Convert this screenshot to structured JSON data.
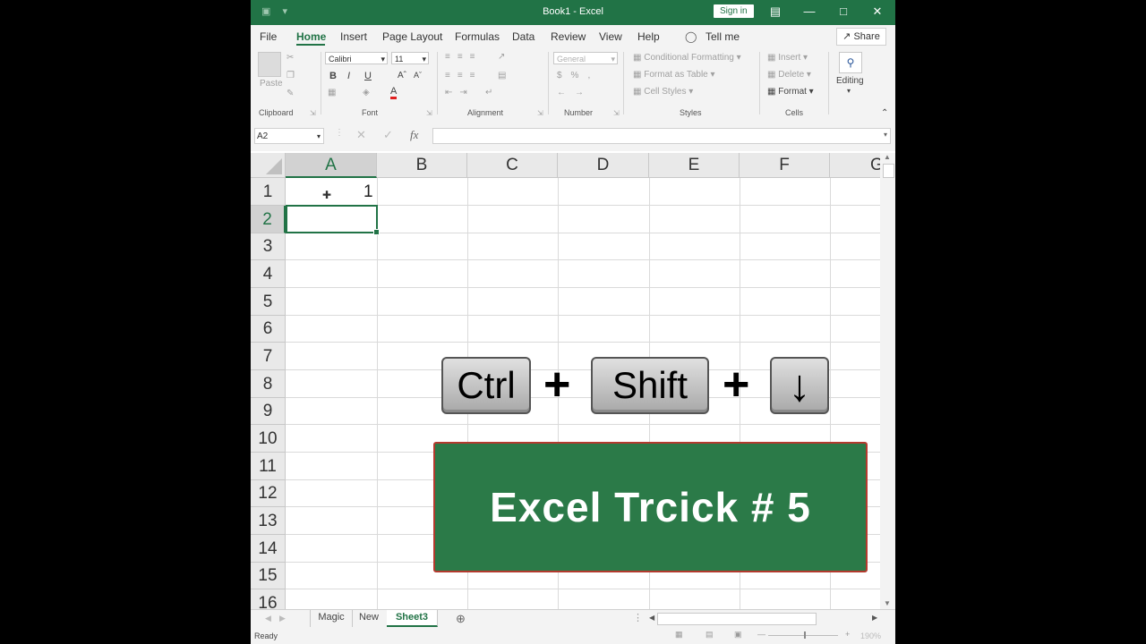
{
  "titlebar": {
    "title": "Book1  -  Excel",
    "signin": "Sign in"
  },
  "menu": {
    "tabs": [
      "File",
      "Home",
      "Insert",
      "Page Layout",
      "Formulas",
      "Data",
      "Review",
      "View",
      "Help"
    ],
    "tell_me": "Tell me",
    "share": "Share"
  },
  "ribbon": {
    "clipboard": {
      "paste": "Paste",
      "label": "Clipboard"
    },
    "font": {
      "name": "Calibri",
      "size": "11",
      "bold": "B",
      "italic": "I",
      "underline": "U",
      "label": "Font"
    },
    "alignment": {
      "label": "Alignment"
    },
    "number": {
      "format": "General",
      "label": "Number"
    },
    "styles": {
      "conditional": "Conditional Formatting",
      "table": "Format as Table",
      "cell_styles": "Cell Styles",
      "label": "Styles"
    },
    "cells": {
      "insert": "Insert",
      "delete": "Delete",
      "format": "Format",
      "label": "Cells"
    },
    "editing": {
      "label": "Editing"
    }
  },
  "formula_bar": {
    "name_box": "A2",
    "fx": "fx",
    "value": ""
  },
  "grid": {
    "columns": [
      "A",
      "B",
      "C",
      "D",
      "E",
      "F",
      "G"
    ],
    "rows": [
      "1",
      "2",
      "3",
      "4",
      "5",
      "6",
      "7",
      "8",
      "9",
      "10",
      "11",
      "12",
      "13",
      "14",
      "15",
      "16"
    ],
    "cells": {
      "A1": "1"
    },
    "active_cell": "A2"
  },
  "sheets": {
    "tabs": [
      "Magic",
      "New",
      "Sheet3"
    ],
    "active": "Sheet3"
  },
  "status": {
    "text": "Ready",
    "zoom": "190%"
  },
  "overlay": {
    "keys": [
      "Ctrl",
      "Shift",
      "↓"
    ],
    "plus": "+",
    "banner": "Excel Trcick # 5"
  }
}
